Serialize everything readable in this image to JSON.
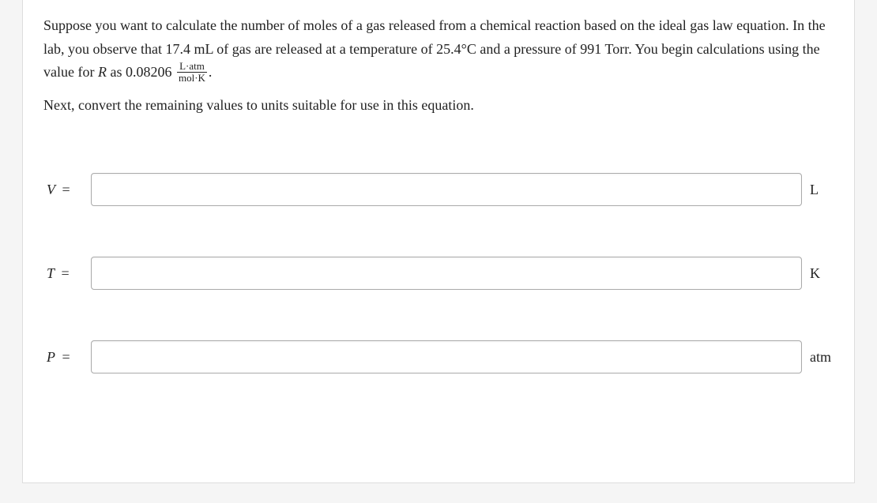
{
  "prompt": {
    "p1_a": "Suppose you want to calculate the number of moles of a gas released from a chemical reaction based on the ideal gas law equation. In the lab, you observe that 17.4 mL of gas are released at a temperature of 25.4°C and a pressure of 991 Torr. You begin calculations using the value for ",
    "p1_r": "R",
    "p1_b": " as 0.08206 ",
    "frac_num": "L·atm",
    "frac_den": "mol·K",
    "p1_c": ".",
    "p2": "Next, convert the remaining values to units suitable for use in this equation."
  },
  "inputs": {
    "v": {
      "label": "V",
      "value": "",
      "unit": "L"
    },
    "t": {
      "label": "T",
      "value": "",
      "unit": "K"
    },
    "p": {
      "label": "P",
      "value": "",
      "unit": "atm"
    }
  }
}
